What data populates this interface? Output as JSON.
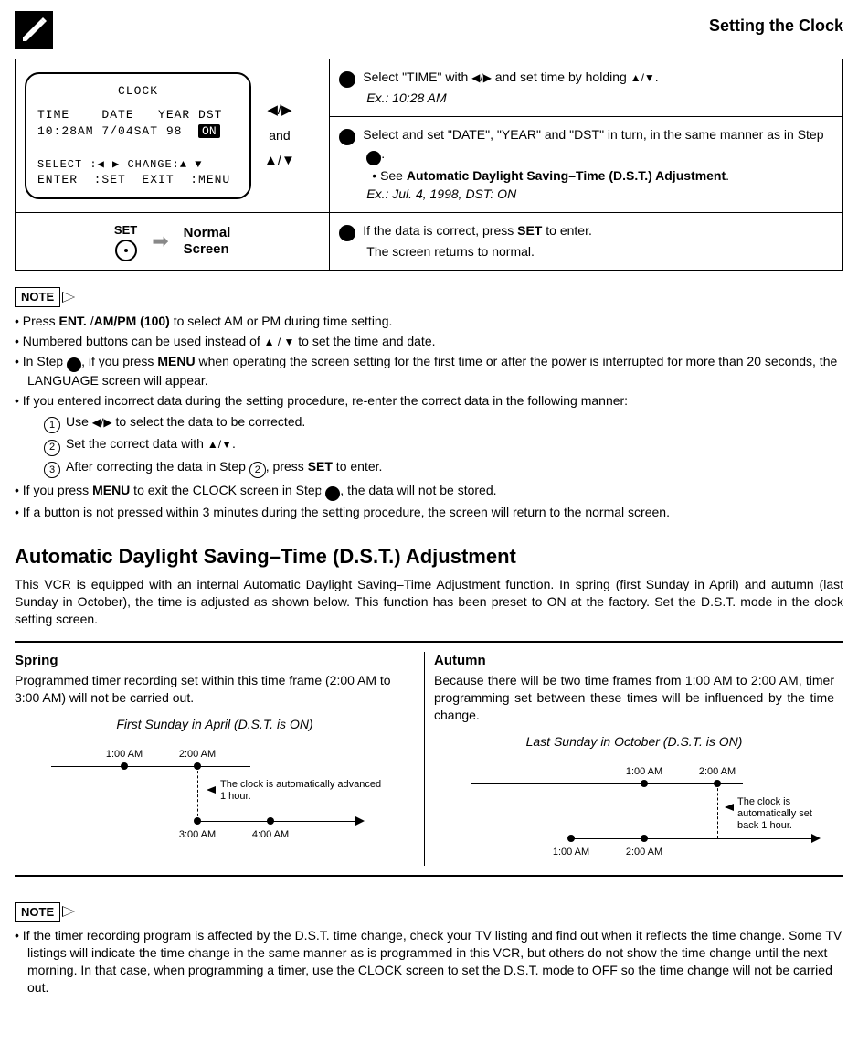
{
  "page_title": "Setting the Clock",
  "osd": {
    "title": "CLOCK",
    "header": "TIME    DATE   YEAR DST",
    "values_pre": "10:28AM 7/04SAT 98  ",
    "on": "ON",
    "help1": "SELECT :◀ ▶  CHANGE:▲ ▼",
    "help2": "ENTER  :SET  EXIT  :MENU"
  },
  "side": {
    "lr": "◀/▶",
    "and": "and",
    "ud": "▲/▼"
  },
  "steps": {
    "s3a": "Select \"TIME\" with ",
    "s3b": " and set time by holding ",
    "s3c": ".",
    "s3ex": "Ex.: 10:28 AM",
    "s4a": "Select and set \"DATE\", \"YEAR\" and \"DST\" in turn, in the same manner as in Step ",
    "s4b": ".",
    "s4sub_pre": "See ",
    "s4sub_bold": "Automatic Daylight Saving–Time (D.S.T.) Adjustment",
    "s4sub_post": ".",
    "s4ex": "Ex.: Jul. 4, 1998, DST: ON",
    "s5a": "If the data is correct, press ",
    "s5b": " to enter.",
    "s5c": "The screen returns to normal."
  },
  "set_label": "SET",
  "normal_screen_l1": "Normal",
  "normal_screen_l2": "Screen",
  "note_label": "NOTE",
  "notes1": {
    "n1a": "Press ",
    "n1b": "ENT. ",
    "n1c": "/",
    "n1d": "AM/PM (100)",
    "n1e": " to select AM or PM during time setting.",
    "n2a": "Numbered buttons can be used instead of ",
    "n2b": " to set the time and date.",
    "n3a": "In Step ",
    "n3b": ", if you press ",
    "n3c": "MENU",
    "n3d": " when operating the screen setting for the first time or after the power is interrupted for more than 20 seconds, the LANGUAGE screen will appear.",
    "n4": "If you entered incorrect data during the setting procedure, re-enter the correct data in the following manner:",
    "c1a": "Use ",
    "c1b": " to select the data to be corrected.",
    "c2a": "Set the correct data with ",
    "c2b": ".",
    "c3a": "After correcting the data in Step ",
    "c3b": ", press ",
    "c3c": "SET",
    "c3d": " to enter.",
    "n5a": "If you press ",
    "n5b": "MENU",
    "n5c": " to exit the CLOCK screen in Step ",
    "n5d": ", the data will not be stored.",
    "n6": "If a button is not pressed within 3 minutes during the setting procedure, the screen will return to the normal screen."
  },
  "dst": {
    "heading": "Automatic Daylight Saving–Time (D.S.T.) Adjustment",
    "intro": "This VCR is equipped with an internal Automatic Daylight Saving–Time Adjustment function. In spring (first Sunday in April) and autumn (last Sunday in October), the time is adjusted as shown below. This function has been preset to ON at the factory. Set the D.S.T. mode in the clock setting screen.",
    "spring_h": "Spring",
    "spring_p": "Programmed timer recording set within this time frame (2:00 AM to 3:00 AM) will not be carried out.",
    "spring_title": "First Sunday in April (D.S.T. is ON)",
    "spring_top1": "1:00 AM",
    "spring_top2": "2:00 AM",
    "spring_bot1": "3:00 AM",
    "spring_bot2": "4:00 AM",
    "spring_callout": "The clock is automatically advanced 1 hour.",
    "autumn_h": "Autumn",
    "autumn_p": "Because there will be two time frames from 1:00 AM to 2:00 AM, timer programming set between these times will be influenced by the time change.",
    "autumn_title": "Last Sunday in October (D.S.T. is ON)",
    "autumn_top1": "1:00 AM",
    "autumn_top2": "2:00 AM",
    "autumn_bot1": "1:00 AM",
    "autumn_bot2": "2:00 AM",
    "autumn_callout": "The clock is automatically set back 1 hour."
  },
  "notes2": {
    "n1": "If the timer recording program is affected by the D.S.T. time change, check your TV listing and find out when it reflects the time change. Some TV listings will indicate the time change in the same manner as is programmed in this VCR, but others do not show the time change until the next morning. In that case, when programming a timer, use the CLOCK screen to set the D.S.T. mode to OFF so the time change will not be carried out."
  },
  "glyphs": {
    "lr": "◀/▶",
    "ud": "▲/▼",
    "ud_sp": "▲ / ▼"
  }
}
